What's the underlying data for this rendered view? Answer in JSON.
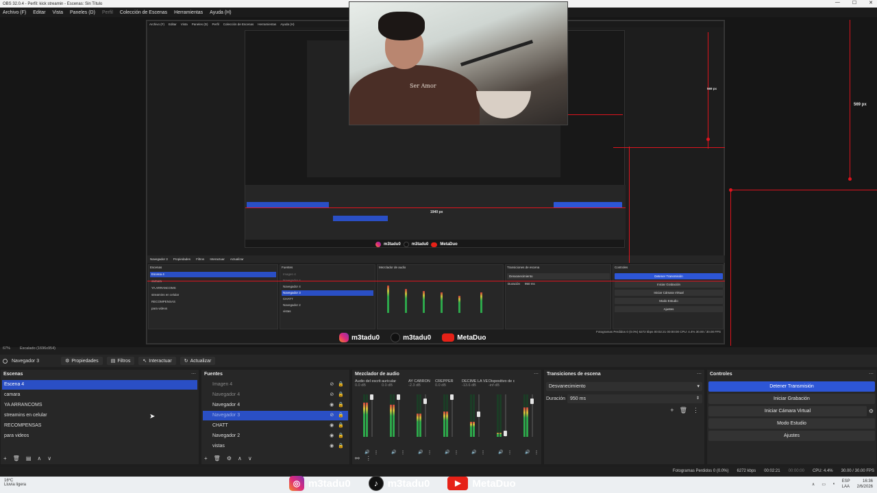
{
  "window": {
    "title": "OBS 32.0.4 - Perfil: kick streamin - Escenas: Sin Título",
    "controls": [
      "—",
      "☐",
      "✕"
    ]
  },
  "menu": {
    "items": [
      "Archivo (F)",
      "Editar",
      "Vista",
      "Paneles (D)",
      "Perfil",
      "Colección de Escenas",
      "Herramientas",
      "Ayuda (H)"
    ],
    "disabled_index": 4
  },
  "preview": {
    "px_label_1": "569 px",
    "px_label_2": "1940 px",
    "zoom": "67%",
    "scaling": "Escalado (1696x954)",
    "shirt_text": "Ser Amor"
  },
  "inner_obs": {
    "menu": [
      "Archivo (F)",
      "Editar",
      "Vista",
      "Paneles (D)",
      "Perfil",
      "Colección de Escenas",
      "Herramientas",
      "Ayuda (H)"
    ],
    "context_source": "Navegador 3",
    "context_buttons": [
      "Propiedades",
      "Filtros",
      "Interactuar",
      "Actualizar"
    ],
    "scenes_title": "Escenas",
    "scenes": [
      "Escena 4",
      "camara",
      "YA ARRANCOMS",
      "streamins en celular",
      "RECOMPENSAS",
      "para videos"
    ],
    "sources_title": "Fuentes",
    "sources": [
      "Imagen 4",
      "Navegador 4",
      "Navegador 4",
      "Navegador 3",
      "CHATT",
      "Navegador 2",
      "vistas"
    ],
    "mixer_title": "Mezclador de audio",
    "transitions_title": "Transiciones de escena",
    "transition": "Desvanecimiento",
    "duration_label": "Duración",
    "duration": "950 ms",
    "controls_title": "Controles",
    "controls": [
      "Detener Transmisión",
      "Iniciar Grabación",
      "Iniciar Cámara Virtual",
      "Modo Estudio",
      "Ajustes"
    ],
    "status": "Fotogramas Perdidos 0 (0.0%)  6272 kbps  00:02:21  00:00:00  CPU: 4.4%  30.00 / 30.00 FPS"
  },
  "context": {
    "source": "Navegador 3",
    "buttons": {
      "properties": "Propiedades",
      "filters": "Filtros",
      "interact": "Interactuar",
      "refresh": "Actualizar"
    }
  },
  "scenes": {
    "title": "Escenas",
    "items": [
      "Escena 4",
      "camara",
      "YA ARRANCOMS",
      "streamins en celular",
      "RECOMPENSAS",
      "para videos"
    ],
    "selected": 0
  },
  "sources": {
    "title": "Fuentes",
    "items": [
      {
        "label": "Imagen 4",
        "dim": true
      },
      {
        "label": "Navegador 4",
        "dim": true
      },
      {
        "label": "Navegador 4",
        "dim": false
      },
      {
        "label": "Navegador 3",
        "dim": true,
        "selected": true
      },
      {
        "label": "CHATT",
        "dim": false
      },
      {
        "label": "Navegador 2",
        "dim": false
      },
      {
        "label": "vistas",
        "dim": false
      }
    ]
  },
  "mixer": {
    "title": "Mezclador de audio",
    "channels": [
      {
        "name": "Audio del escritorio",
        "db": "0.0 dB",
        "level": 0.8,
        "fader": 1.0
      },
      {
        "name": "auricular",
        "db": "0.0 dB",
        "level": 0.75,
        "fader": 1.0
      },
      {
        "name": "AY CABRON",
        "db": "-2.3 dB",
        "level": 0.55,
        "fader": 0.9
      },
      {
        "name": "CREPPER",
        "db": "0.0 dB",
        "level": 0.6,
        "fader": 1.0
      },
      {
        "name": "DECIME LA VERDAD",
        "db": "-13.6 dB",
        "level": 0.35,
        "fader": 0.6
      },
      {
        "name": "Dispositivo de captura",
        "db": "-inf dB",
        "level": 0.1,
        "fader": 0.15
      },
      {
        "name": "",
        "db": "",
        "level": 0.7,
        "fader": 0.9
      }
    ]
  },
  "transitions": {
    "title": "Transiciones de escena",
    "selected": "Desvanecimiento",
    "duration_label": "Duración",
    "duration": "950 ms"
  },
  "controls": {
    "title": "Controles",
    "stop_stream": "Detener Transmisión",
    "start_recording": "Iniciar Grabación",
    "start_virtual_cam": "Iniciar Cámara Virtual",
    "studio_mode": "Modo Estudio",
    "settings": "Ajustes"
  },
  "status": {
    "dropped_frames": "Fotogramas Perdidos 0 (0.0%)",
    "bitrate": "6272 kbps",
    "stream_time": "00:02:21",
    "record_time": "00:00:00",
    "cpu": "CPU: 4.4%",
    "fps": "30.00 / 30.00 FPS"
  },
  "socials": {
    "instagram": "m3tadu0",
    "tiktok": "m3tadu0",
    "youtube": "MetaDuo"
  },
  "taskbar": {
    "weather_temp": "16ºC",
    "weather_desc": "Lluvia ligera",
    "lang": "ESP",
    "lang2": "LAA",
    "time": "16:36",
    "date": "2/6/2026"
  },
  "colors": {
    "accent_blue": "#2a4fc5",
    "guide_red": "#e0141e"
  }
}
